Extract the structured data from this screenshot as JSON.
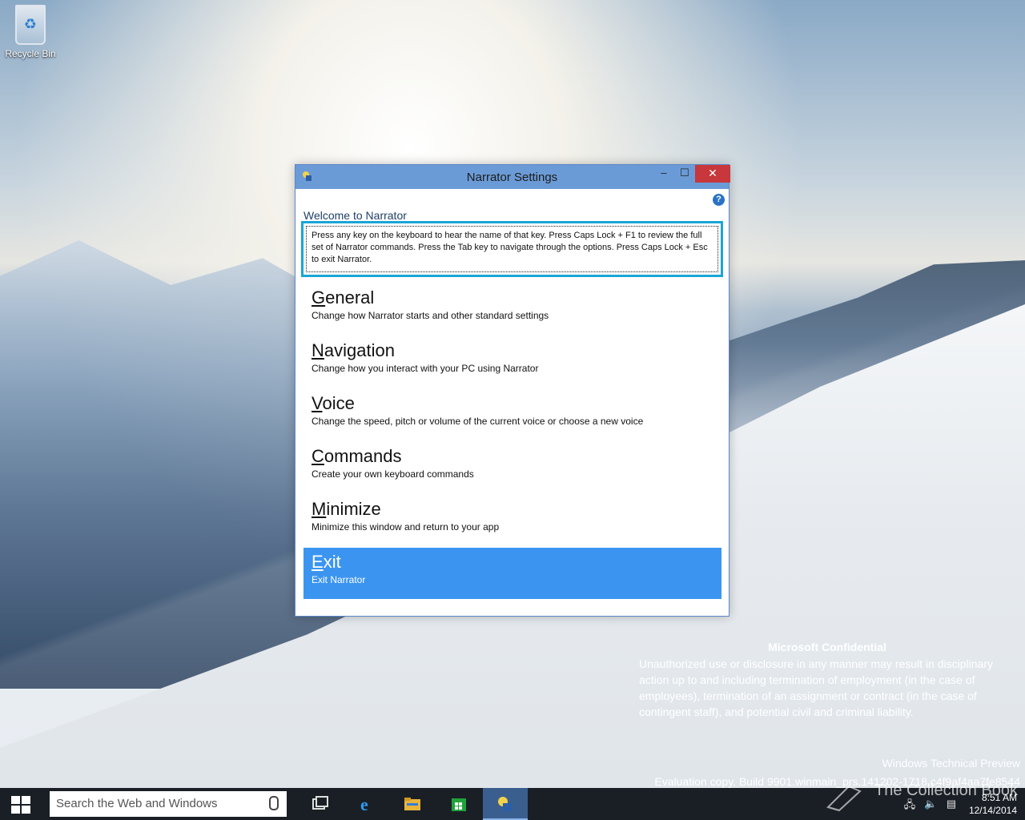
{
  "desktop": {
    "icons": [
      {
        "label": "Recycle Bin",
        "icon": "recycle-bin-icon"
      }
    ]
  },
  "window": {
    "title": "Narrator Settings",
    "controls": {
      "minimize": "–",
      "maximize": "☐",
      "close": "✕"
    },
    "help_icon": "?",
    "welcome": "Welcome to Narrator",
    "description": "Press any key on the keyboard to hear the name of that key.  Press Caps Lock + F1 to review the full set of Narrator commands.  Press the Tab key to navigate through the options.  Press Caps Lock + Esc to exit Narrator.",
    "options": [
      {
        "access": "G",
        "rest": "eneral",
        "sub": "Change how Narrator starts and other standard settings",
        "selected": false
      },
      {
        "access": "N",
        "rest": "avigation",
        "sub": "Change how you interact with your PC using Narrator",
        "selected": false
      },
      {
        "access": "V",
        "rest": "oice",
        "sub": "Change the speed, pitch or volume of the current voice or choose a new voice",
        "selected": false
      },
      {
        "access": "C",
        "rest": "ommands",
        "sub": "Create your own keyboard commands",
        "selected": false
      },
      {
        "access": "M",
        "rest": "inimize",
        "sub": "Minimize this window and return to your app",
        "selected": false
      },
      {
        "access": "E",
        "rest": "xit",
        "sub": "Exit Narrator",
        "selected": true
      }
    ],
    "accent": "#3b95f0",
    "focus_color": "#1aa6d6",
    "close_color": "#c7373b"
  },
  "watermark": {
    "title": "Microsoft Confidential",
    "body": "Unauthorized use or disclosure in any manner may result in disciplinary action up to and including termination of employment (in the case of employees), termination of an assignment or contract (in the case of contingent staff), and potential civil and criminal liability.",
    "edition": "Windows Technical Preview",
    "build": "Evaluation copy. Build 9901.winmain_prs.141202-1718.c4f9af4aa7fe8544",
    "brand": "The Collection Book"
  },
  "taskbar": {
    "search_placeholder": "Search the Web and Windows",
    "apps": [
      "task-view-icon",
      "internet-explorer-icon",
      "file-explorer-icon",
      "store-icon",
      "narrator-icon"
    ],
    "time": "8:51 AM",
    "date": "12/14/2014"
  }
}
